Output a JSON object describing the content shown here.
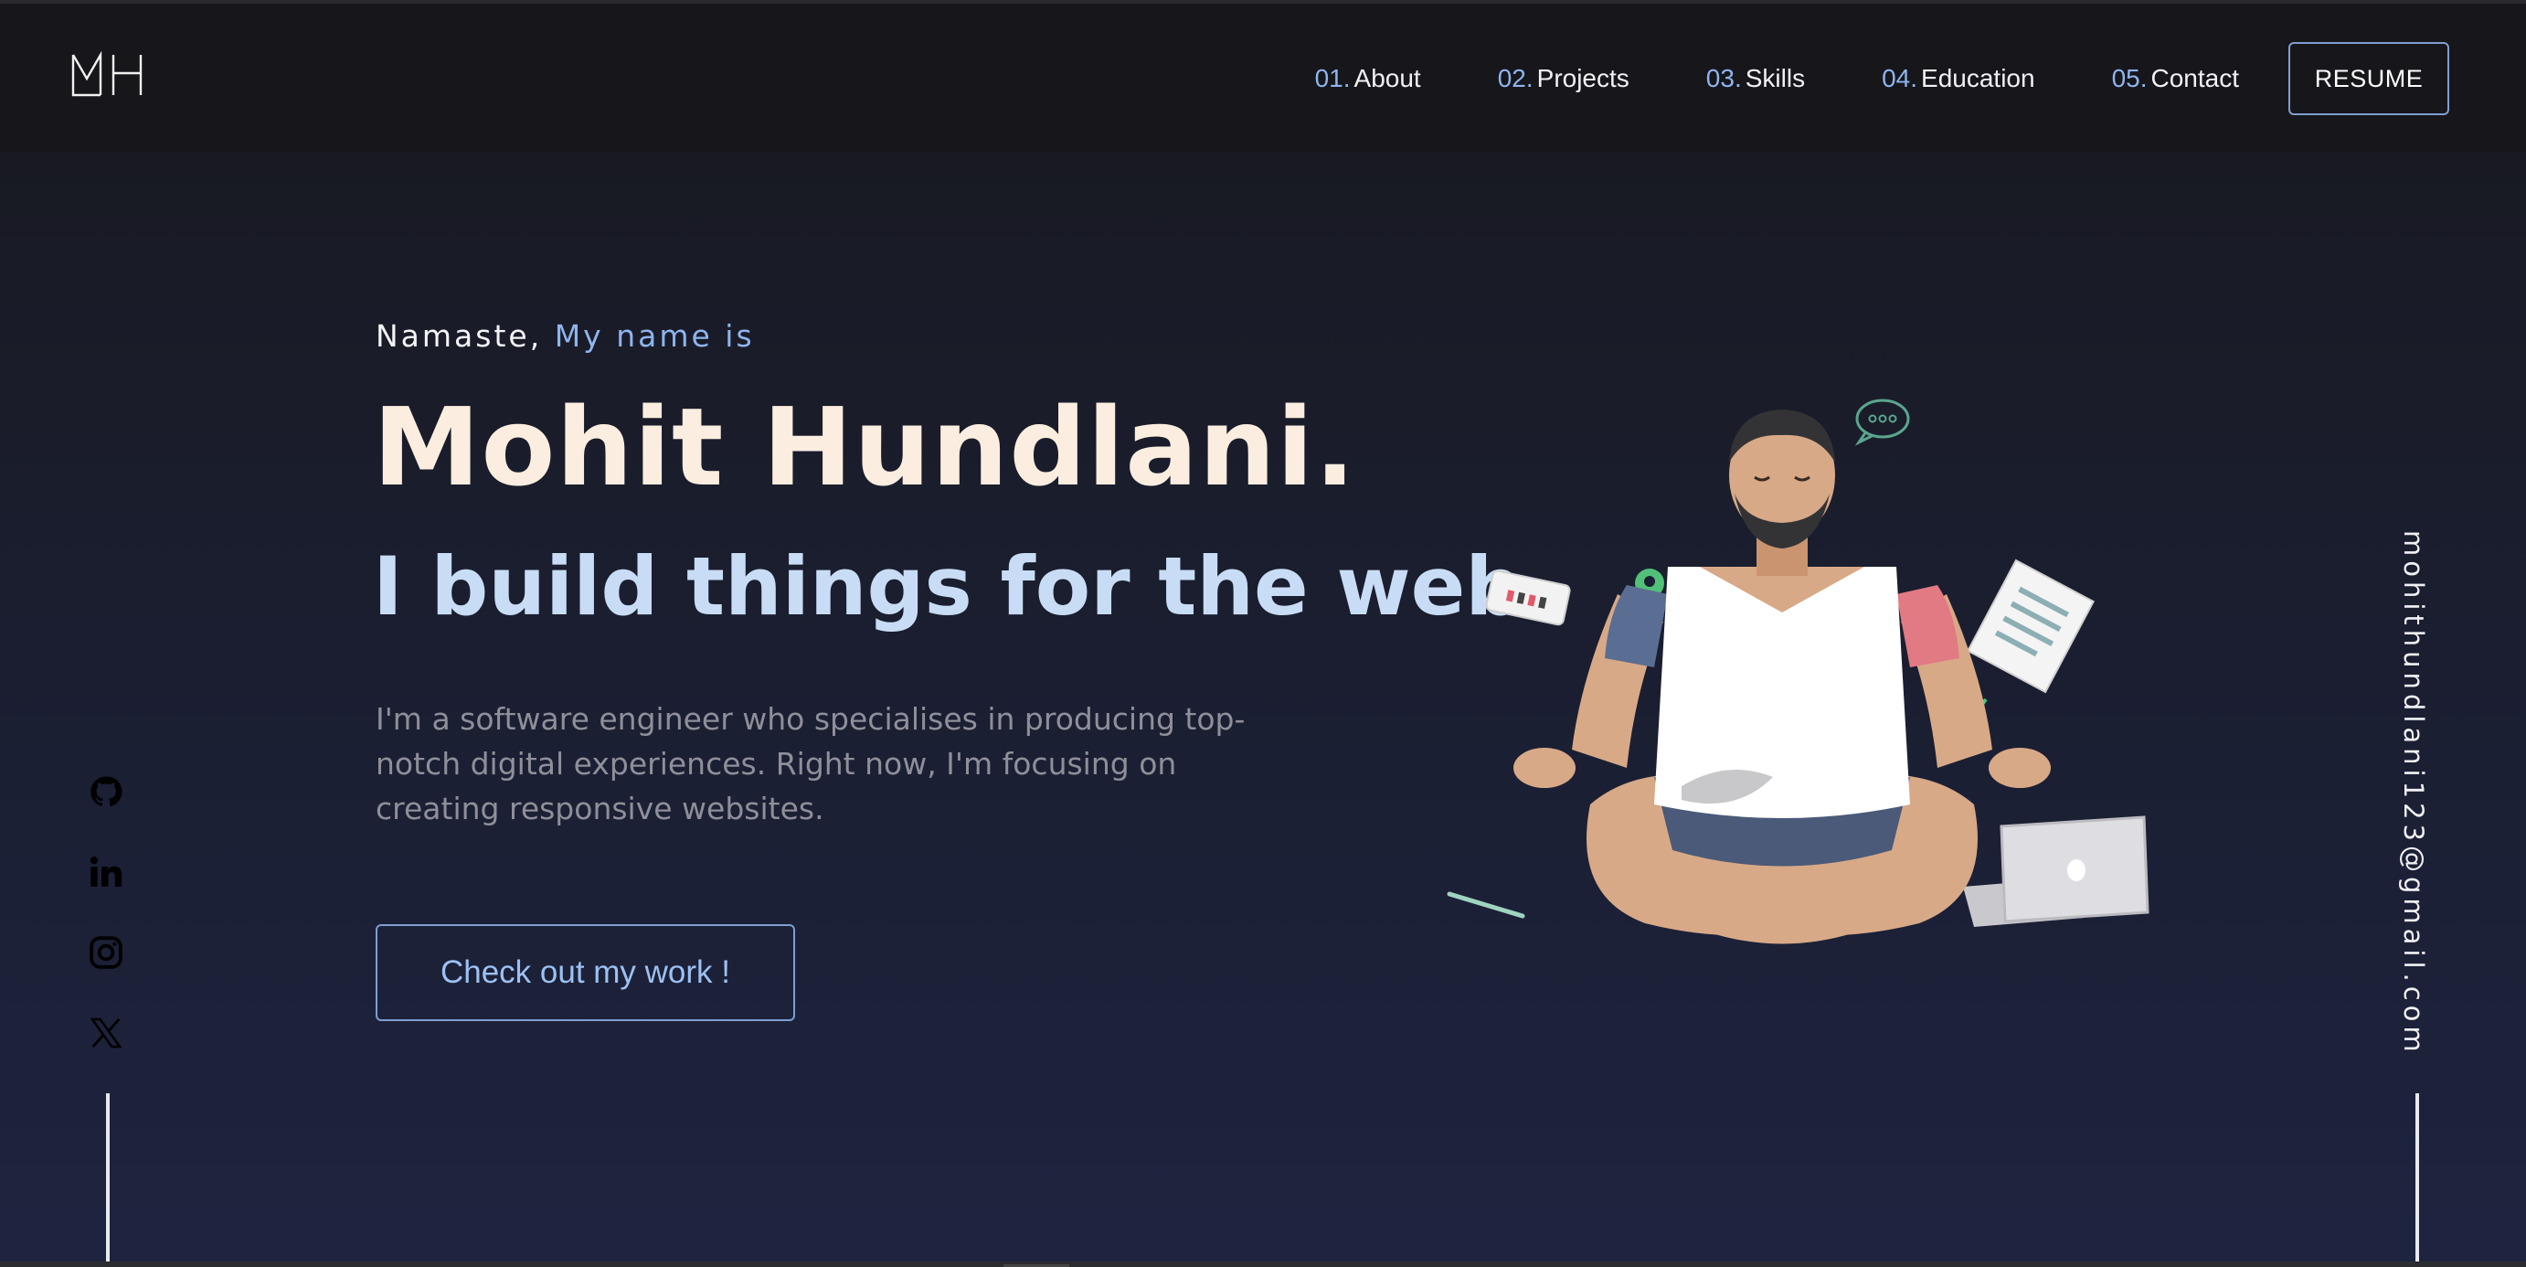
{
  "header": {
    "logo_text": "MH",
    "nav": [
      {
        "num": "01.",
        "label": "About"
      },
      {
        "num": "02.",
        "label": "Projects"
      },
      {
        "num": "03.",
        "label": "Skills"
      },
      {
        "num": "04.",
        "label": "Education"
      },
      {
        "num": "05.",
        "label": "Contact"
      }
    ],
    "resume_label": "RESUME"
  },
  "hero": {
    "greeting_part1": "Namaste,",
    "greeting_part2": "My name is",
    "name": "Mohit Hundlani.",
    "tagline": "I build things for the web.",
    "bio": "I'm a software engineer who specialises in producing top-notch digital experiences. Right now, I'm focusing on creating responsive websites.",
    "cta_label": "Check out my work !"
  },
  "social_icons": [
    "github-icon",
    "linkedin-icon",
    "instagram-icon",
    "x-twitter-icon"
  ],
  "email": "mohithundlani123@gmail.com",
  "colors": {
    "accent": "#8fb4ee",
    "name": "#fbeee0",
    "tagline": "#c8ddf5",
    "body_text": "#8e8f99",
    "background_top": "#16161c",
    "background_bottom": "#1e2440"
  }
}
